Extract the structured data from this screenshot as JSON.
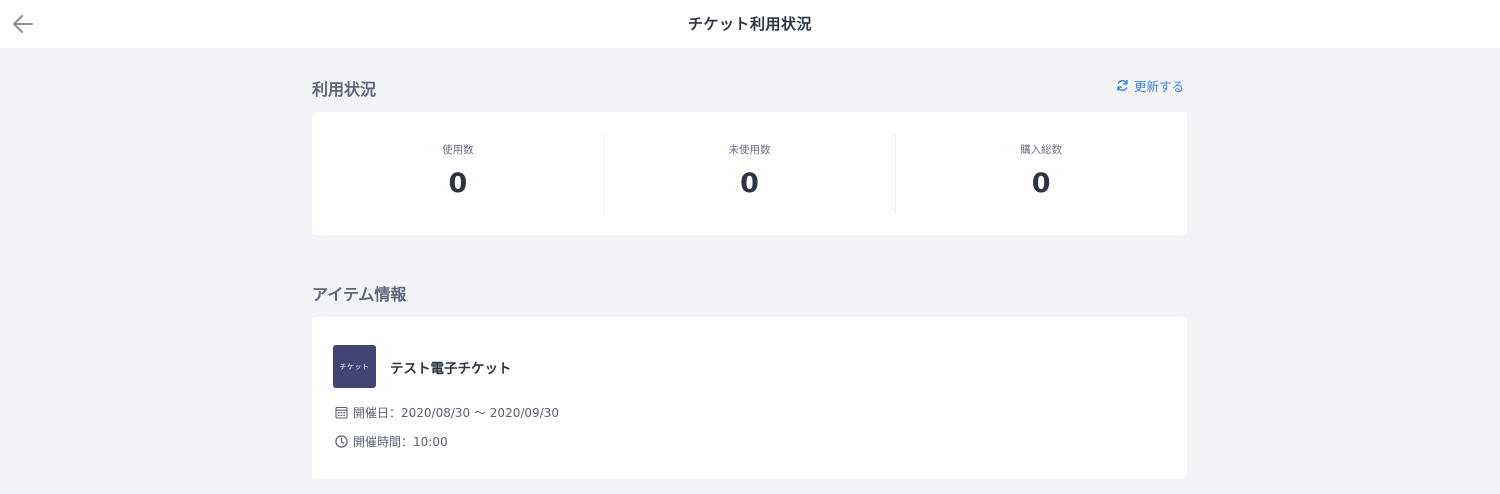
{
  "header": {
    "title": "チケット利用状況",
    "back_icon": "arrow-left-icon"
  },
  "usage": {
    "heading": "利用状況",
    "refresh_label": "更新する",
    "refresh_icon": "refresh-icon",
    "accent_color": "#3b82e6",
    "stats": [
      {
        "label": "使用数",
        "value": "0"
      },
      {
        "label": "未使用数",
        "value": "0"
      },
      {
        "label": "購入総数",
        "value": "0"
      }
    ]
  },
  "item_info": {
    "heading": "アイテム情報",
    "thumbnail_text": "チケット",
    "thumbnail_color": "#3f4674",
    "name": "テスト電子チケット",
    "date_label": "開催日：2020/08/30 〜 2020/09/30",
    "date_icon": "calendar-icon",
    "time_label": "開催時間：10:00",
    "time_icon": "clock-icon"
  }
}
